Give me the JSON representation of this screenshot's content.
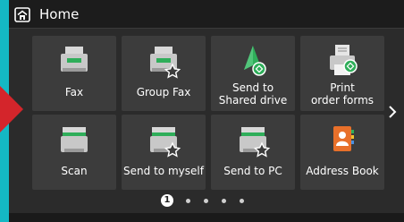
{
  "header": {
    "title": "Home",
    "icon": "home-icon"
  },
  "tiles": [
    {
      "id": "fax",
      "label": "Fax",
      "icon": "fax-icon"
    },
    {
      "id": "group-fax",
      "label": "Group Fax",
      "icon": "group-fax-icon"
    },
    {
      "id": "send-to-shared-drive",
      "label_line1": "Send to",
      "label_line2": "Shared drive",
      "icon": "shared-drive-icon"
    },
    {
      "id": "print-order-forms",
      "label_line1": "Print",
      "label_line2": "order forms",
      "icon": "print-forms-icon"
    },
    {
      "id": "scan",
      "label": "Scan",
      "icon": "scan-icon"
    },
    {
      "id": "send-to-myself",
      "label": "Send to myself",
      "icon": "send-to-myself-icon"
    },
    {
      "id": "send-to-pc",
      "label": "Send to PC",
      "icon": "send-to-pc-icon"
    },
    {
      "id": "address-book",
      "label": "Address Book",
      "icon": "address-book-icon"
    }
  ],
  "pager": {
    "current_page": "1",
    "total_pages": 5
  },
  "colors": {
    "accent_green": "#2fae5a",
    "address_book_orange": "#e8702a",
    "marker_red": "#d4252b",
    "background_teal": "#14b8c4"
  }
}
